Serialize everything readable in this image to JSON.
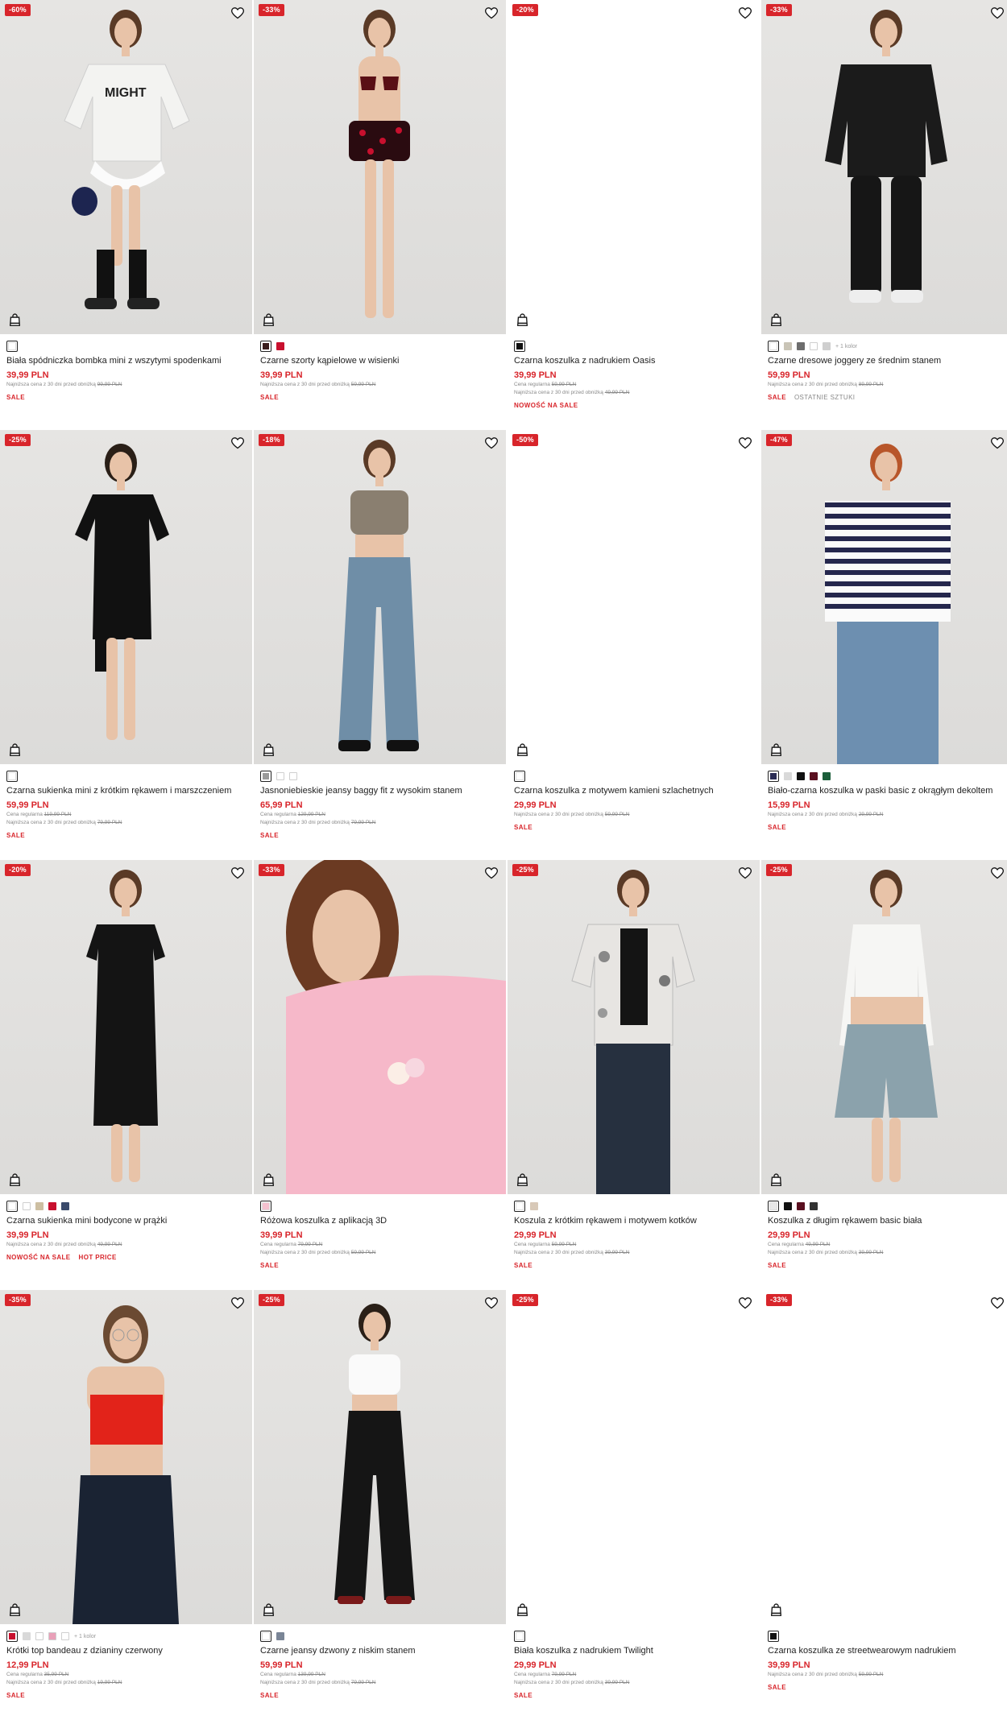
{
  "products": [
    {
      "badge": "-60%",
      "photo": "studio",
      "figure": "skirt",
      "swatches": [
        [
          "#ffffff",
          true
        ]
      ],
      "more": "",
      "name": "Biała spódniczka bombka mini z wszytymi spodenkami",
      "price": "39,99 PLN",
      "notes": [
        {
          "label": "Najniższa cena z 30 dni przed obniżką",
          "value": "99,99 PLN"
        }
      ],
      "tags": [
        {
          "text": "SALE",
          "grey": false
        }
      ]
    },
    {
      "badge": "-33%",
      "photo": "studio",
      "figure": "swim",
      "swatches": [
        [
          "#3a1d1d",
          true
        ],
        [
          "#c8102e",
          false
        ]
      ],
      "more": "",
      "name": "Czarne szorty kąpielowe w wisienki",
      "price": "39,99 PLN",
      "notes": [
        {
          "label": "Najniższa cena z 30 dni przed obniżką",
          "value": "59,99 PLN"
        }
      ],
      "tags": [
        {
          "text": "SALE",
          "grey": false
        }
      ]
    },
    {
      "badge": "-20%",
      "photo": "blank",
      "figure": "",
      "swatches": [
        [
          "#111111",
          true
        ]
      ],
      "more": "",
      "name": "Czarna koszulka z nadrukiem Oasis",
      "price": "39,99 PLN",
      "notes": [
        {
          "label": "Cena regularna",
          "value": "59,99 PLN"
        },
        {
          "label": "Najniższa cena z 30 dni przed obniżką",
          "value": "49,99 PLN"
        }
      ],
      "tags": [
        {
          "text": "NOWOŚĆ NA SALE",
          "grey": false
        }
      ]
    },
    {
      "badge": "-33%",
      "photo": "studio",
      "figure": "hoodie",
      "swatches": [
        [
          "#ffffff",
          true
        ],
        [
          "#c9c4b6",
          false
        ],
        [
          "#6d6d6d",
          false
        ],
        [
          "#ffffff",
          false
        ],
        [
          "#cfcfcf",
          false
        ]
      ],
      "more": "+ 1 kolor",
      "name": "Czarne dresowe joggery ze średnim stanem",
      "price": "59,99 PLN",
      "notes": [
        {
          "label": "Najniższa cena z 30 dni przed obniżką",
          "value": "89,99 PLN"
        }
      ],
      "tags": [
        {
          "text": "SALE",
          "grey": false
        },
        {
          "text": "OSTATNIE SZTUKI",
          "grey": true
        }
      ]
    },
    {
      "badge": "-25%",
      "photo": "studio",
      "figure": "blackdress",
      "swatches": [
        [
          "#ffffff",
          true
        ]
      ],
      "more": "",
      "name": "Czarna sukienka mini z krótkim rękawem i marszczeniem",
      "price": "59,99 PLN",
      "notes": [
        {
          "label": "Cena regularna",
          "value": "119,99 PLN"
        },
        {
          "label": "Najniższa cena z 30 dni przed obniżką",
          "value": "79,99 PLN"
        }
      ],
      "tags": [
        {
          "text": "SALE",
          "grey": false
        }
      ]
    },
    {
      "badge": "-18%",
      "photo": "studio",
      "figure": "jeans",
      "swatches": [
        [
          "#9a9a9a",
          true
        ],
        [
          "#ffffff",
          false
        ],
        [
          "#ffffff",
          false
        ]
      ],
      "more": "",
      "name": "Jasnoniebieskie jeansy baggy fit z wysokim stanem",
      "price": "65,99 PLN",
      "notes": [
        {
          "label": "Cena regularna",
          "value": "129,99 PLN"
        },
        {
          "label": "Najniższa cena z 30 dni przed obniżką",
          "value": "79,99 PLN"
        }
      ],
      "tags": [
        {
          "text": "SALE",
          "grey": false
        }
      ]
    },
    {
      "badge": "-50%",
      "photo": "blank",
      "figure": "",
      "swatches": [
        [
          "#ffffff",
          true
        ]
      ],
      "more": "",
      "name": "Czarna koszulka z motywem kamieni szlachetnych",
      "price": "29,99 PLN",
      "notes": [
        {
          "label": "Najniższa cena z 30 dni przed obniżką",
          "value": "59,99 PLN"
        }
      ],
      "tags": [
        {
          "text": "SALE",
          "grey": false
        }
      ]
    },
    {
      "badge": "-47%",
      "photo": "studio",
      "figure": "stripes",
      "swatches": [
        [
          "#2b2d55",
          true
        ],
        [
          "#d9d9d9",
          false
        ],
        [
          "#111111",
          false
        ],
        [
          "#5a1020",
          false
        ],
        [
          "#1b5e3a",
          false
        ]
      ],
      "more": "",
      "name": "Biało-czarna koszulka w paski basic z okrągłym dekoltem",
      "price": "15,99 PLN",
      "notes": [
        {
          "label": "Najniższa cena z 30 dni przed obniżką",
          "value": "29,99 PLN"
        }
      ],
      "tags": [
        {
          "text": "SALE",
          "grey": false
        }
      ]
    },
    {
      "badge": "-20%",
      "photo": "studio",
      "figure": "bodycon",
      "swatches": [
        [
          "#ffffff",
          true
        ],
        [
          "#ffffff",
          false
        ],
        [
          "#cdbfa2",
          false
        ],
        [
          "#c8102e",
          false
        ],
        [
          "#3a4a6b",
          false
        ]
      ],
      "more": "",
      "name": "Czarna sukienka mini bodycone w prążki",
      "price": "39,99 PLN",
      "notes": [
        {
          "label": "Najniższa cena z 30 dni przed obniżką",
          "value": "49,99 PLN"
        }
      ],
      "tags": [
        {
          "text": "NOWOŚĆ NA SALE",
          "grey": false
        },
        {
          "text": "HOT PRICE",
          "grey": false
        }
      ]
    },
    {
      "badge": "-33%",
      "photo": "studio",
      "figure": "pinktee",
      "swatches": [
        [
          "#f4c1cf",
          true
        ]
      ],
      "more": "",
      "name": "Różowa koszulka z aplikacją 3D",
      "price": "39,99 PLN",
      "notes": [
        {
          "label": "Cena regularna",
          "value": "79,99 PLN"
        },
        {
          "label": "Najniższa cena z 30 dni przed obniżką",
          "value": "59,99 PLN"
        }
      ],
      "tags": [
        {
          "text": "SALE",
          "grey": false
        }
      ]
    },
    {
      "badge": "-25%",
      "photo": "studio",
      "figure": "catshirt",
      "swatches": [
        [
          "#ffffff",
          true
        ],
        [
          "#d8c9b8",
          false
        ]
      ],
      "more": "",
      "name": "Koszula z krótkim rękawem i motywem kotków",
      "price": "29,99 PLN",
      "notes": [
        {
          "label": "Cena regularna",
          "value": "59,99 PLN"
        },
        {
          "label": "Najniższa cena z 30 dni przed obniżką",
          "value": "39,99 PLN"
        }
      ],
      "tags": [
        {
          "text": "SALE",
          "grey": false
        }
      ]
    },
    {
      "badge": "-25%",
      "photo": "studio",
      "figure": "longsleeve",
      "swatches": [
        [
          "#e8e8e8",
          true
        ],
        [
          "#111111",
          false
        ],
        [
          "#5a1020",
          false
        ],
        [
          "#333333",
          false
        ]
      ],
      "more": "",
      "name": "Koszulka z długim rękawem basic biała",
      "price": "29,99 PLN",
      "notes": [
        {
          "label": "Cena regularna",
          "value": "49,99 PLN"
        },
        {
          "label": "Najniższa cena z 30 dni przed obniżką",
          "value": "39,99 PLN"
        }
      ],
      "tags": [
        {
          "text": "SALE",
          "grey": false
        }
      ]
    },
    {
      "badge": "-35%",
      "photo": "studio",
      "figure": "bandeau",
      "swatches": [
        [
          "#c8102e",
          true
        ],
        [
          "#d9d9d9",
          false
        ],
        [
          "#ffffff",
          false
        ],
        [
          "#e9a0b8",
          false
        ],
        [
          "#ffffff",
          false
        ]
      ],
      "more": "+ 1 kolor",
      "name": "Krótki top bandeau z dzianiny czerwony",
      "price": "12,99 PLN",
      "notes": [
        {
          "label": "Cena regularna",
          "value": "35,99 PLN"
        },
        {
          "label": "Najniższa cena z 30 dni przed obniżką",
          "value": "19,99 PLN"
        }
      ],
      "tags": [
        {
          "text": "SALE",
          "grey": false
        }
      ]
    },
    {
      "badge": "-25%",
      "photo": "studio",
      "figure": "flare",
      "swatches": [
        [
          "#ffffff",
          true
        ],
        [
          "#7a8596",
          false
        ]
      ],
      "more": "",
      "name": "Czarne jeansy dzwony z niskim stanem",
      "price": "59,99 PLN",
      "notes": [
        {
          "label": "Cena regularna",
          "value": "139,99 PLN"
        },
        {
          "label": "Najniższa cena z 30 dni przed obniżką",
          "value": "79,99 PLN"
        }
      ],
      "tags": [
        {
          "text": "SALE",
          "grey": false
        }
      ]
    },
    {
      "badge": "-25%",
      "photo": "blank",
      "figure": "",
      "swatches": [
        [
          "#ffffff",
          true
        ]
      ],
      "more": "",
      "name": "Biała koszulka z nadrukiem Twilight",
      "price": "29,99 PLN",
      "notes": [
        {
          "label": "Cena regularna",
          "value": "79,99 PLN"
        },
        {
          "label": "Najniższa cena z 30 dni przed obniżką",
          "value": "39,99 PLN"
        }
      ],
      "tags": [
        {
          "text": "SALE",
          "grey": false
        }
      ]
    },
    {
      "badge": "-33%",
      "photo": "blank",
      "figure": "",
      "swatches": [
        [
          "#111111",
          true
        ]
      ],
      "more": "",
      "name": "Czarna koszulka ze streetwearowym nadrukiem",
      "price": "39,99 PLN",
      "notes": [
        {
          "label": "Najniższa cena z 30 dni przed obniżką",
          "value": "59,99 PLN"
        }
      ],
      "tags": [
        {
          "text": "SALE",
          "grey": false
        }
      ]
    }
  ],
  "icons": {
    "wishlist": "heart-icon",
    "cart": "shopping-bag-icon"
  },
  "colors": {
    "accent": "#d8252b",
    "muted": "#888888",
    "text": "#222222"
  }
}
